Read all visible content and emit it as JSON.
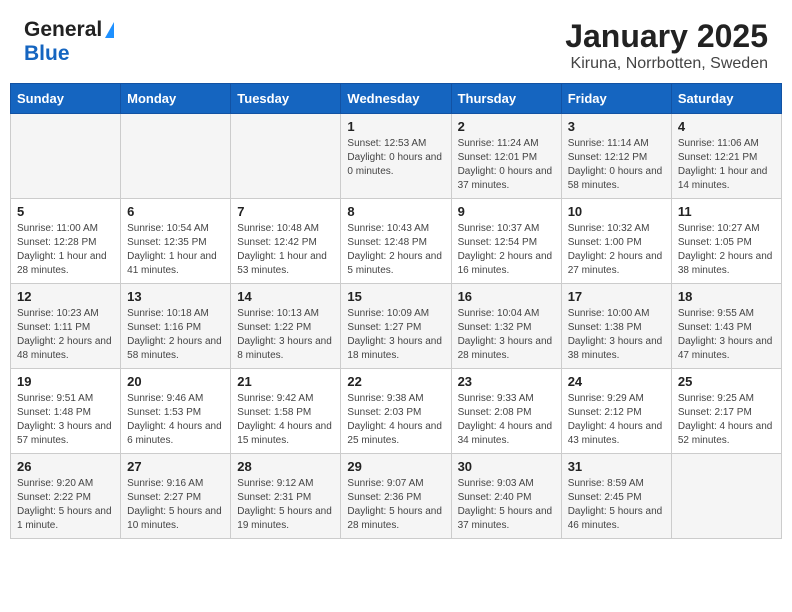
{
  "header": {
    "logo_line1": "General",
    "logo_line2": "Blue",
    "title": "January 2025",
    "subtitle": "Kiruna, Norrbotten, Sweden"
  },
  "weekdays": [
    "Sunday",
    "Monday",
    "Tuesday",
    "Wednesday",
    "Thursday",
    "Friday",
    "Saturday"
  ],
  "weeks": [
    [
      {
        "day": "",
        "info": ""
      },
      {
        "day": "",
        "info": ""
      },
      {
        "day": "",
        "info": ""
      },
      {
        "day": "1",
        "info": "Sunset: 12:53 AM\nDaylight: 0 hours and 0 minutes."
      },
      {
        "day": "2",
        "info": "Sunrise: 11:24 AM\nSunset: 12:01 PM\nDaylight: 0 hours and 37 minutes."
      },
      {
        "day": "3",
        "info": "Sunrise: 11:14 AM\nSunset: 12:12 PM\nDaylight: 0 hours and 58 minutes."
      },
      {
        "day": "4",
        "info": "Sunrise: 11:06 AM\nSunset: 12:21 PM\nDaylight: 1 hour and 14 minutes."
      }
    ],
    [
      {
        "day": "5",
        "info": "Sunrise: 11:00 AM\nSunset: 12:28 PM\nDaylight: 1 hour and 28 minutes."
      },
      {
        "day": "6",
        "info": "Sunrise: 10:54 AM\nSunset: 12:35 PM\nDaylight: 1 hour and 41 minutes."
      },
      {
        "day": "7",
        "info": "Sunrise: 10:48 AM\nSunset: 12:42 PM\nDaylight: 1 hour and 53 minutes."
      },
      {
        "day": "8",
        "info": "Sunrise: 10:43 AM\nSunset: 12:48 PM\nDaylight: 2 hours and 5 minutes."
      },
      {
        "day": "9",
        "info": "Sunrise: 10:37 AM\nSunset: 12:54 PM\nDaylight: 2 hours and 16 minutes."
      },
      {
        "day": "10",
        "info": "Sunrise: 10:32 AM\nSunset: 1:00 PM\nDaylight: 2 hours and 27 minutes."
      },
      {
        "day": "11",
        "info": "Sunrise: 10:27 AM\nSunset: 1:05 PM\nDaylight: 2 hours and 38 minutes."
      }
    ],
    [
      {
        "day": "12",
        "info": "Sunrise: 10:23 AM\nSunset: 1:11 PM\nDaylight: 2 hours and 48 minutes."
      },
      {
        "day": "13",
        "info": "Sunrise: 10:18 AM\nSunset: 1:16 PM\nDaylight: 2 hours and 58 minutes."
      },
      {
        "day": "14",
        "info": "Sunrise: 10:13 AM\nSunset: 1:22 PM\nDaylight: 3 hours and 8 minutes."
      },
      {
        "day": "15",
        "info": "Sunrise: 10:09 AM\nSunset: 1:27 PM\nDaylight: 3 hours and 18 minutes."
      },
      {
        "day": "16",
        "info": "Sunrise: 10:04 AM\nSunset: 1:32 PM\nDaylight: 3 hours and 28 minutes."
      },
      {
        "day": "17",
        "info": "Sunrise: 10:00 AM\nSunset: 1:38 PM\nDaylight: 3 hours and 38 minutes."
      },
      {
        "day": "18",
        "info": "Sunrise: 9:55 AM\nSunset: 1:43 PM\nDaylight: 3 hours and 47 minutes."
      }
    ],
    [
      {
        "day": "19",
        "info": "Sunrise: 9:51 AM\nSunset: 1:48 PM\nDaylight: 3 hours and 57 minutes."
      },
      {
        "day": "20",
        "info": "Sunrise: 9:46 AM\nSunset: 1:53 PM\nDaylight: 4 hours and 6 minutes."
      },
      {
        "day": "21",
        "info": "Sunrise: 9:42 AM\nSunset: 1:58 PM\nDaylight: 4 hours and 15 minutes."
      },
      {
        "day": "22",
        "info": "Sunrise: 9:38 AM\nSunset: 2:03 PM\nDaylight: 4 hours and 25 minutes."
      },
      {
        "day": "23",
        "info": "Sunrise: 9:33 AM\nSunset: 2:08 PM\nDaylight: 4 hours and 34 minutes."
      },
      {
        "day": "24",
        "info": "Sunrise: 9:29 AM\nSunset: 2:12 PM\nDaylight: 4 hours and 43 minutes."
      },
      {
        "day": "25",
        "info": "Sunrise: 9:25 AM\nSunset: 2:17 PM\nDaylight: 4 hours and 52 minutes."
      }
    ],
    [
      {
        "day": "26",
        "info": "Sunrise: 9:20 AM\nSunset: 2:22 PM\nDaylight: 5 hours and 1 minute."
      },
      {
        "day": "27",
        "info": "Sunrise: 9:16 AM\nSunset: 2:27 PM\nDaylight: 5 hours and 10 minutes."
      },
      {
        "day": "28",
        "info": "Sunrise: 9:12 AM\nSunset: 2:31 PM\nDaylight: 5 hours and 19 minutes."
      },
      {
        "day": "29",
        "info": "Sunrise: 9:07 AM\nSunset: 2:36 PM\nDaylight: 5 hours and 28 minutes."
      },
      {
        "day": "30",
        "info": "Sunrise: 9:03 AM\nSunset: 2:40 PM\nDaylight: 5 hours and 37 minutes."
      },
      {
        "day": "31",
        "info": "Sunrise: 8:59 AM\nSunset: 2:45 PM\nDaylight: 5 hours and 46 minutes."
      },
      {
        "day": "",
        "info": ""
      }
    ]
  ]
}
